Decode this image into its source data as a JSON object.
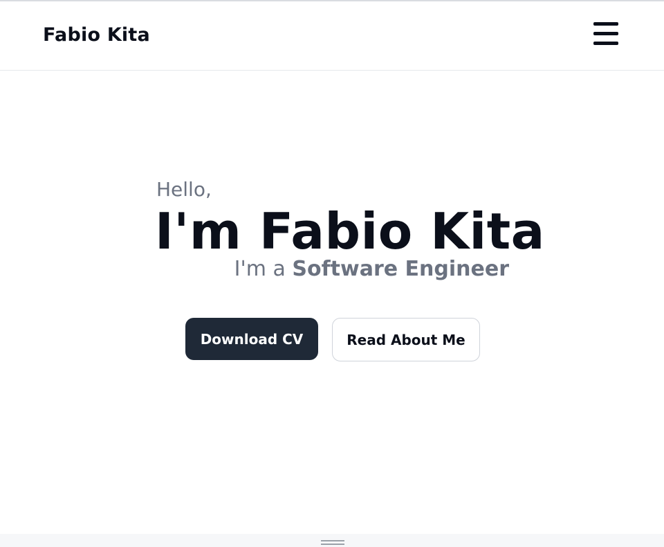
{
  "navbar": {
    "brand": "Fabio Kita",
    "menu_icon": "hamburger-menu-icon"
  },
  "hero": {
    "greeting": "Hello,",
    "name": "I'm Fabio Kita",
    "role_prefix": "I'm a ",
    "role": "Software Engineer"
  },
  "actions": {
    "primary_label": "Download CV",
    "secondary_label": "Read About Me"
  },
  "colors": {
    "text_dark": "#0b0f1a",
    "text_muted": "#6b7280",
    "button_primary_bg": "#1f2937",
    "button_secondary_border": "#cfd3da"
  }
}
